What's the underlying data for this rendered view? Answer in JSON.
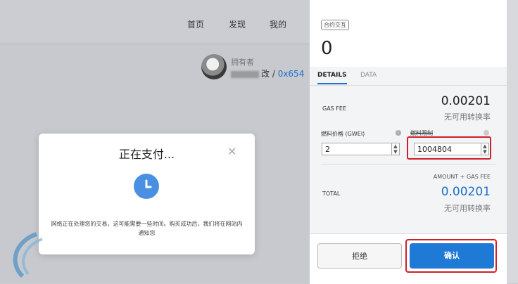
{
  "nav": {
    "home": "首页",
    "discover": "发现",
    "mine": "我的"
  },
  "owner": {
    "label": "拥有者",
    "name_suffix": "改 / ",
    "address": "0x654"
  },
  "modal": {
    "title": "正在支付...",
    "close": "✕",
    "message": "网络正在处理您的交易，这可能需要一些时间。购买成功后，我们将在网站内通知您"
  },
  "wallet": {
    "tag": "合约交互",
    "amount": "0",
    "tabs": [
      "DETAILS",
      "DATA"
    ],
    "gas_fee_label": "GAS FEE",
    "gas_fee_value": "0.00201",
    "gas_fee_note": "无可用转换率",
    "gas_price_label": "燃料价格 (GWEI)",
    "gas_price_value": "2",
    "gas_limit_label": "燃料限制",
    "gas_limit_value": "1004804",
    "amount_gas_label": "AMOUNT + GAS FEE",
    "total_label": "TOTAL",
    "total_value": "0.00201",
    "total_note": "无可用转换率",
    "reject": "拒绝",
    "confirm": "确认"
  },
  "colors": {
    "accent": "#1f7ad6",
    "highlight": "#d01f2a"
  }
}
